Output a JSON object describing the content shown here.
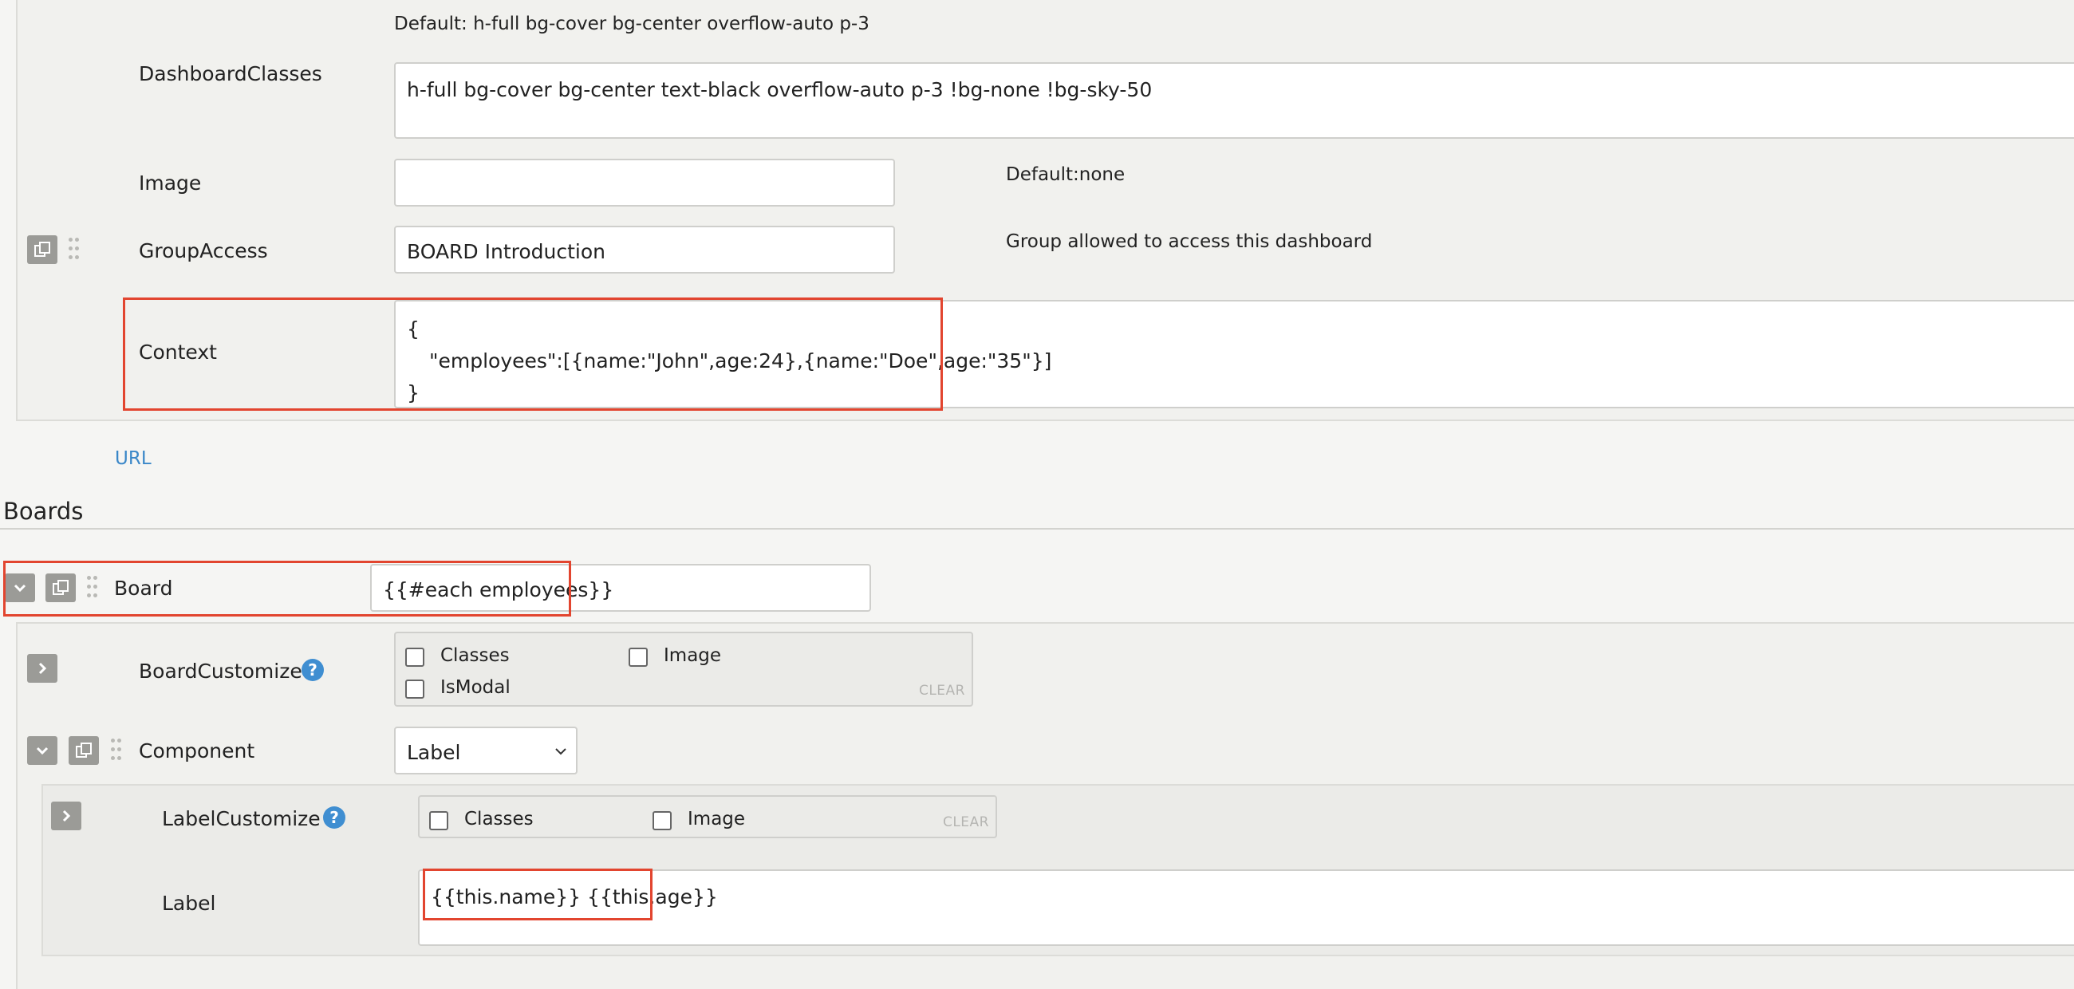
{
  "dashboard": {
    "default_classes_hint": "Default: h-full bg-cover bg-center overflow-auto p-3",
    "dashboard_classes_label": "DashboardClasses",
    "dashboard_classes_value": "h-full bg-cover bg-center text-black overflow-auto p-3 !bg-none !bg-sky-50",
    "image_label": "Image",
    "image_value": "",
    "image_hint": "Default:none",
    "group_access_label": "GroupAccess",
    "group_access_value": "BOARD Introduction",
    "group_access_hint": "Group allowed to access this dashboard",
    "context_label": "Context",
    "context_lines": [
      "{",
      "\"employees\":[{name:\"John\",age:24},{name:\"Doe\",age:\"35\"}]",
      "}"
    ]
  },
  "url_link": "URL",
  "boards_heading": "Boards",
  "board": {
    "label": "Board",
    "value": "{{#each employees}}",
    "customize": {
      "label": "BoardCustomize",
      "options": [
        "Classes",
        "Image",
        "IsModal"
      ],
      "clear": "CLEAR"
    },
    "component": {
      "label": "Component",
      "selected": "Label",
      "customize": {
        "label": "LabelCustomize",
        "options": [
          "Classes",
          "Image"
        ],
        "clear": "CLEAR"
      },
      "label_field_label": "Label",
      "label_field_value": "{{this.name}} {{this.age}}"
    }
  },
  "icons": {
    "copy": "copy-icon",
    "drag": "drag-handle-icon",
    "collapse": "chevron-down-icon",
    "expand": "chevron-right-icon",
    "help": "help-icon",
    "select": "select-chevron-icon"
  },
  "colors": {
    "highlight": "#e2452f",
    "link": "#3a87c8",
    "help": "#3f8ed1"
  }
}
